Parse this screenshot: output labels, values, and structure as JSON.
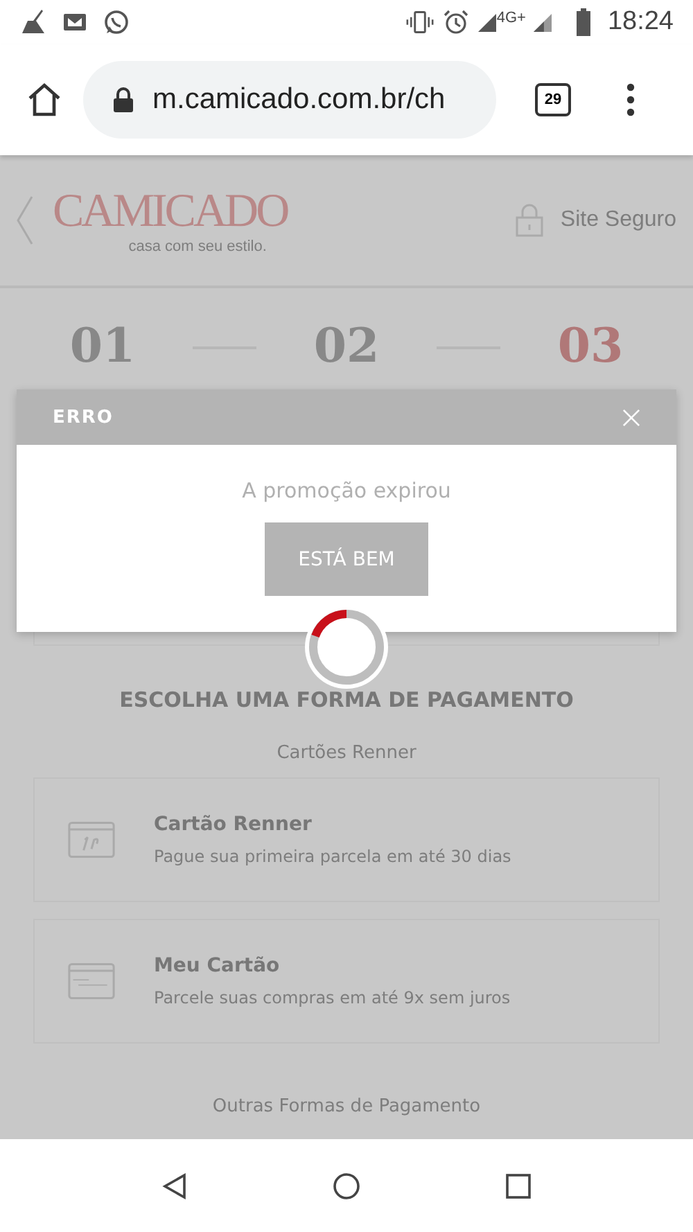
{
  "status_bar": {
    "network": "4G+",
    "time": "18:24"
  },
  "browser": {
    "url": "m.camicado.com.br/ch",
    "tab_count": "29"
  },
  "header": {
    "logo": "CAMICADO",
    "tagline": "casa com seu estilo.",
    "secure_label": "Site Seguro"
  },
  "steps": [
    {
      "number": "01",
      "selected": false
    },
    {
      "number": "02",
      "selected": false
    },
    {
      "number": "03",
      "selected": true
    }
  ],
  "payment": {
    "title": "ESCOLHA UMA FORMA DE PAGAMENTO",
    "groups": [
      {
        "heading": "Cartões Renner",
        "options": [
          {
            "kind": "renner",
            "title": "Cartão Renner",
            "description": "Pague sua primeira parcela em até 30 dias"
          },
          {
            "kind": "meu",
            "title": "Meu Cartão",
            "description": "Parcele suas compras em até 9x sem juros"
          }
        ]
      },
      {
        "heading": "Outras Formas de Pagamento"
      }
    ]
  },
  "dialog": {
    "title": "ERRO",
    "message": "A promoção expirou",
    "button": "ESTÁ BEM"
  }
}
